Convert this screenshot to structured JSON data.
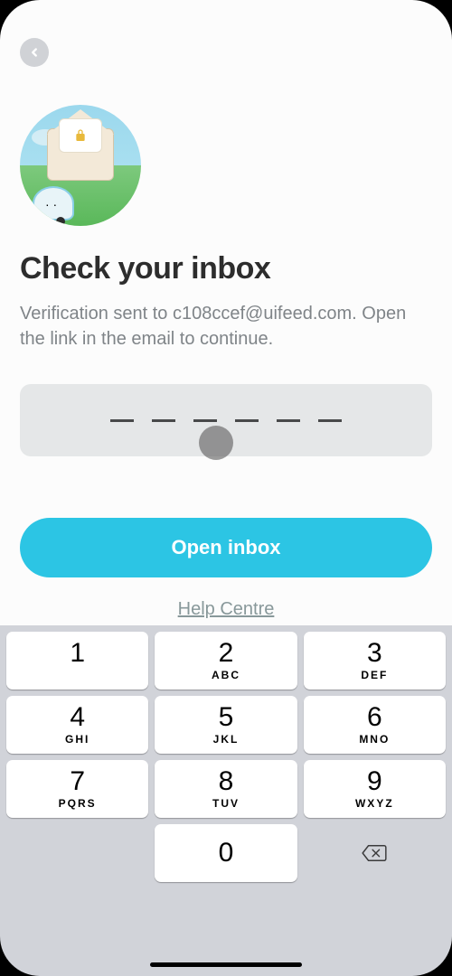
{
  "header": {
    "back_icon": "chevron-left"
  },
  "main": {
    "title": "Check your inbox",
    "description": "Verification sent to c108ccef@uifeed.com. Open the link in the email to continue.",
    "code_slots": 6,
    "open_inbox_label": "Open inbox",
    "help_label": "Help Centre"
  },
  "keypad": {
    "keys": [
      [
        {
          "d": "1",
          "l": ""
        },
        {
          "d": "2",
          "l": "ABC"
        },
        {
          "d": "3",
          "l": "DEF"
        }
      ],
      [
        {
          "d": "4",
          "l": "GHI"
        },
        {
          "d": "5",
          "l": "JKL"
        },
        {
          "d": "6",
          "l": "MNO"
        }
      ],
      [
        {
          "d": "7",
          "l": "PQRS"
        },
        {
          "d": "8",
          "l": "TUV"
        },
        {
          "d": "9",
          "l": "WXYZ"
        }
      ],
      [
        {
          "d": "0",
          "l": ""
        }
      ]
    ],
    "backspace_icon": "backspace"
  }
}
